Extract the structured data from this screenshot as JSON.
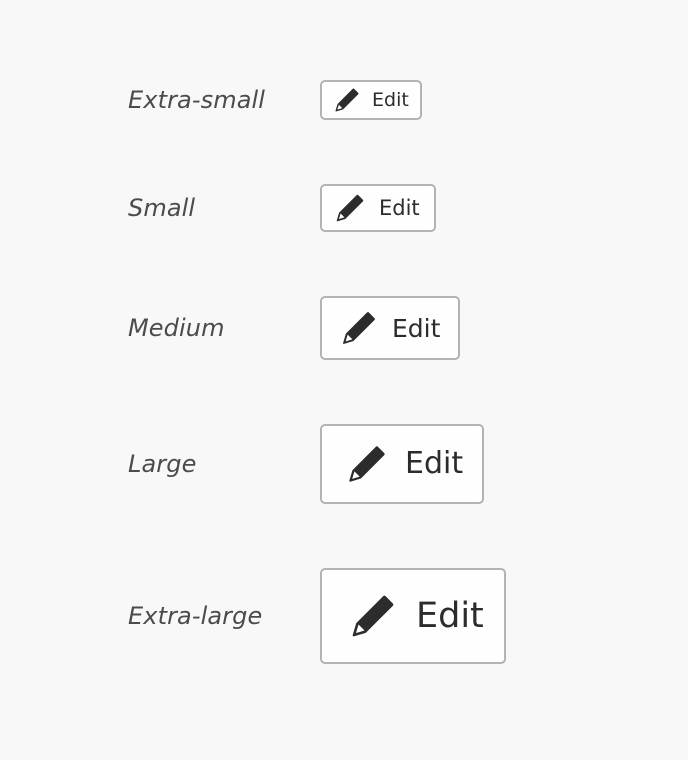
{
  "rows": [
    {
      "size_label": "Extra-small",
      "button": {
        "label": "Edit",
        "icon": "pencil-icon"
      }
    },
    {
      "size_label": "Small",
      "button": {
        "label": "Edit",
        "icon": "pencil-icon"
      }
    },
    {
      "size_label": "Medium",
      "button": {
        "label": "Edit",
        "icon": "pencil-icon"
      }
    },
    {
      "size_label": "Large",
      "button": {
        "label": "Edit",
        "icon": "pencil-icon"
      }
    },
    {
      "size_label": "Extra-large",
      "button": {
        "label": "Edit",
        "icon": "pencil-icon"
      }
    }
  ],
  "colors": {
    "background": "#f8f8f8",
    "button_border": "#b3b3b3",
    "button_background": "#fefefe",
    "text": "#2c2c2c",
    "label_text": "#4b4b4b"
  }
}
